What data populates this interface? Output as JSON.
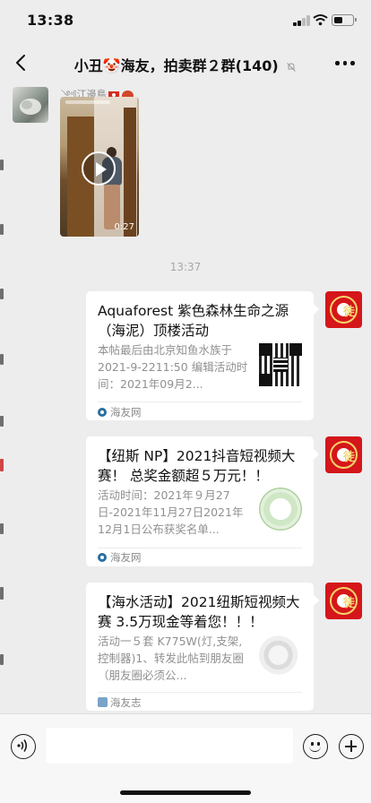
{
  "status_bar": {
    "time": "13:38"
  },
  "header": {
    "title": "小丑🤡海友，拍卖群２群(140)",
    "icons": [
      "back-icon",
      "mute-icon",
      "more-icon"
    ]
  },
  "messages": {
    "sender_name": "༺江邊鳥",
    "video": {
      "duration": "0:27"
    },
    "timestamp": "13:37",
    "cards": [
      {
        "title": "Aquaforest 紫色森林生命之源（海泥）顶楼活动",
        "description": "本帖最后由北京知鱼水族于 2021-9-2211:50 编辑活动时间：2021年09月2...",
        "source": "海友网",
        "thumbnail": "qr-code"
      },
      {
        "title": "【纽斯 NP】2021抖音短视频大赛！ 总奖金额超５万元！！",
        "description": "活动时间：2021年９月27日-2021年11月27日2021年12月1日公布获奖名单...",
        "source": "海友网",
        "thumbnail": "green-logo"
      },
      {
        "title": "【海水活动】2021纽斯短视频大赛 3.5万现金等着您！！！",
        "description": "活动一５套 K775W(灯,支架,控制器)1、转发此帖到朋友圈（朋友圈必须公...",
        "source": "海友志",
        "thumbnail": "gray-logo"
      }
    ]
  },
  "input_bar": {
    "value": "",
    "icons": [
      "voice-icon",
      "emoji-icon",
      "plus-icon"
    ]
  }
}
